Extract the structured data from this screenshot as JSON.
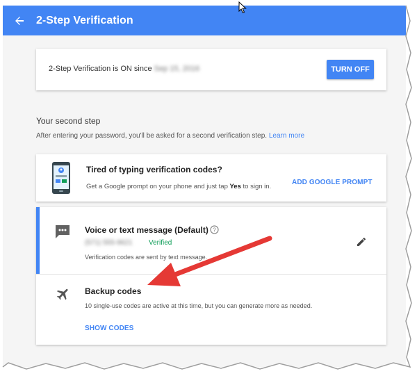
{
  "app_bar": {
    "title": "2-Step Verification",
    "back_icon": "arrow-left-icon"
  },
  "status_card": {
    "status_text": "2-Step Verification is ON since",
    "date_redacted": "Sep 15, 2016",
    "turn_off_label": "TURN OFF"
  },
  "second_step": {
    "heading": "Your second step",
    "description": "After entering your password, you'll be asked for a second verification step.",
    "learn_more": "Learn more"
  },
  "prompt_card": {
    "title": "Tired of typing verification codes?",
    "desc_before": "Get a Google prompt on your phone and just tap",
    "desc_bold": "Yes",
    "desc_after": "to sign in.",
    "action_label": "ADD GOOGLE PROMPT",
    "icon": "phone-icon"
  },
  "voice_method": {
    "title": "Voice or text message (Default)",
    "phone_redacted": "(571) 555-9621",
    "verified_label": "Verified",
    "description": "Verification codes are sent by text message.",
    "icon": "message-icon",
    "help_icon": "help-circle-icon",
    "edit_icon": "pencil-icon"
  },
  "backup_method": {
    "title": "Backup codes",
    "description": "10 single-use codes are active at this time, but you can generate more as needed.",
    "action_label": "SHOW CODES",
    "icon": "airplane-icon"
  },
  "colors": {
    "accent": "#4285f4",
    "verified": "#0f9d58",
    "annotation_arrow": "#e53935"
  }
}
